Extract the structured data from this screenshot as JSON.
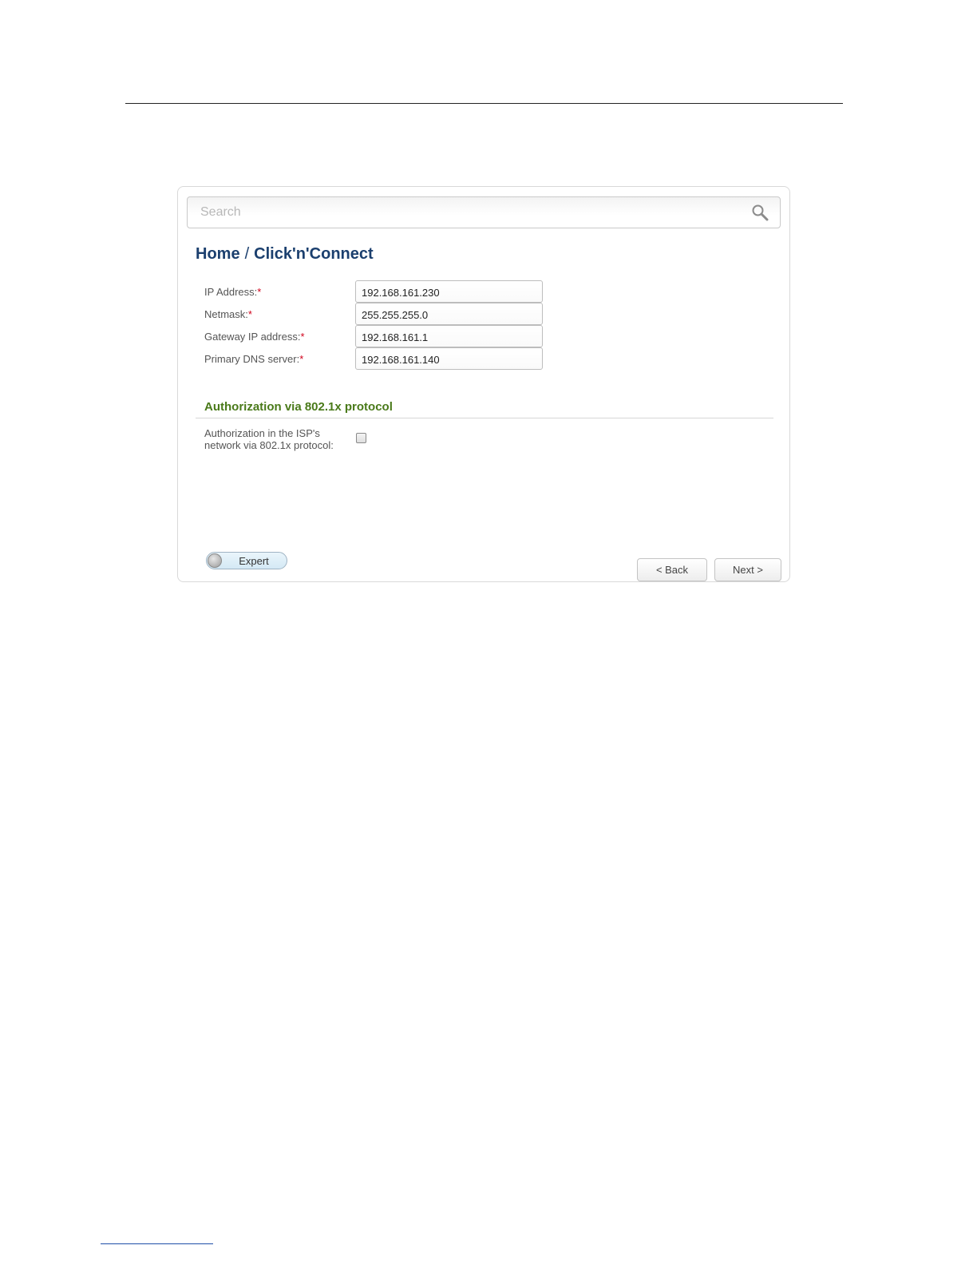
{
  "search": {
    "placeholder": "Search",
    "icon": "search-icon"
  },
  "breadcrumb": {
    "home": "Home",
    "separator": "/",
    "current": "Click'n'Connect"
  },
  "fields": [
    {
      "label": "IP Address:",
      "required": "*",
      "value": "192.168.161.230"
    },
    {
      "label": "Netmask:",
      "required": "*",
      "value": "255.255.255.0"
    },
    {
      "label": "Gateway IP address:",
      "required": "*",
      "value": "192.168.161.1"
    },
    {
      "label": "Primary DNS server:",
      "required": "*",
      "value": "192.168.161.140"
    }
  ],
  "auth_section": {
    "title": "Authorization via 802.1x protocol",
    "checkbox_label_line1": "Authorization in the ISP's",
    "checkbox_label_line2": "network via 802.1x protocol:",
    "checked": false
  },
  "footer": {
    "expert_label": "Expert",
    "back_label": "< Back",
    "next_label": "Next >"
  },
  "colors": {
    "breadcrumb": "#1b3f6e",
    "section_title": "#4a7a1a",
    "required": "#d0021b"
  }
}
